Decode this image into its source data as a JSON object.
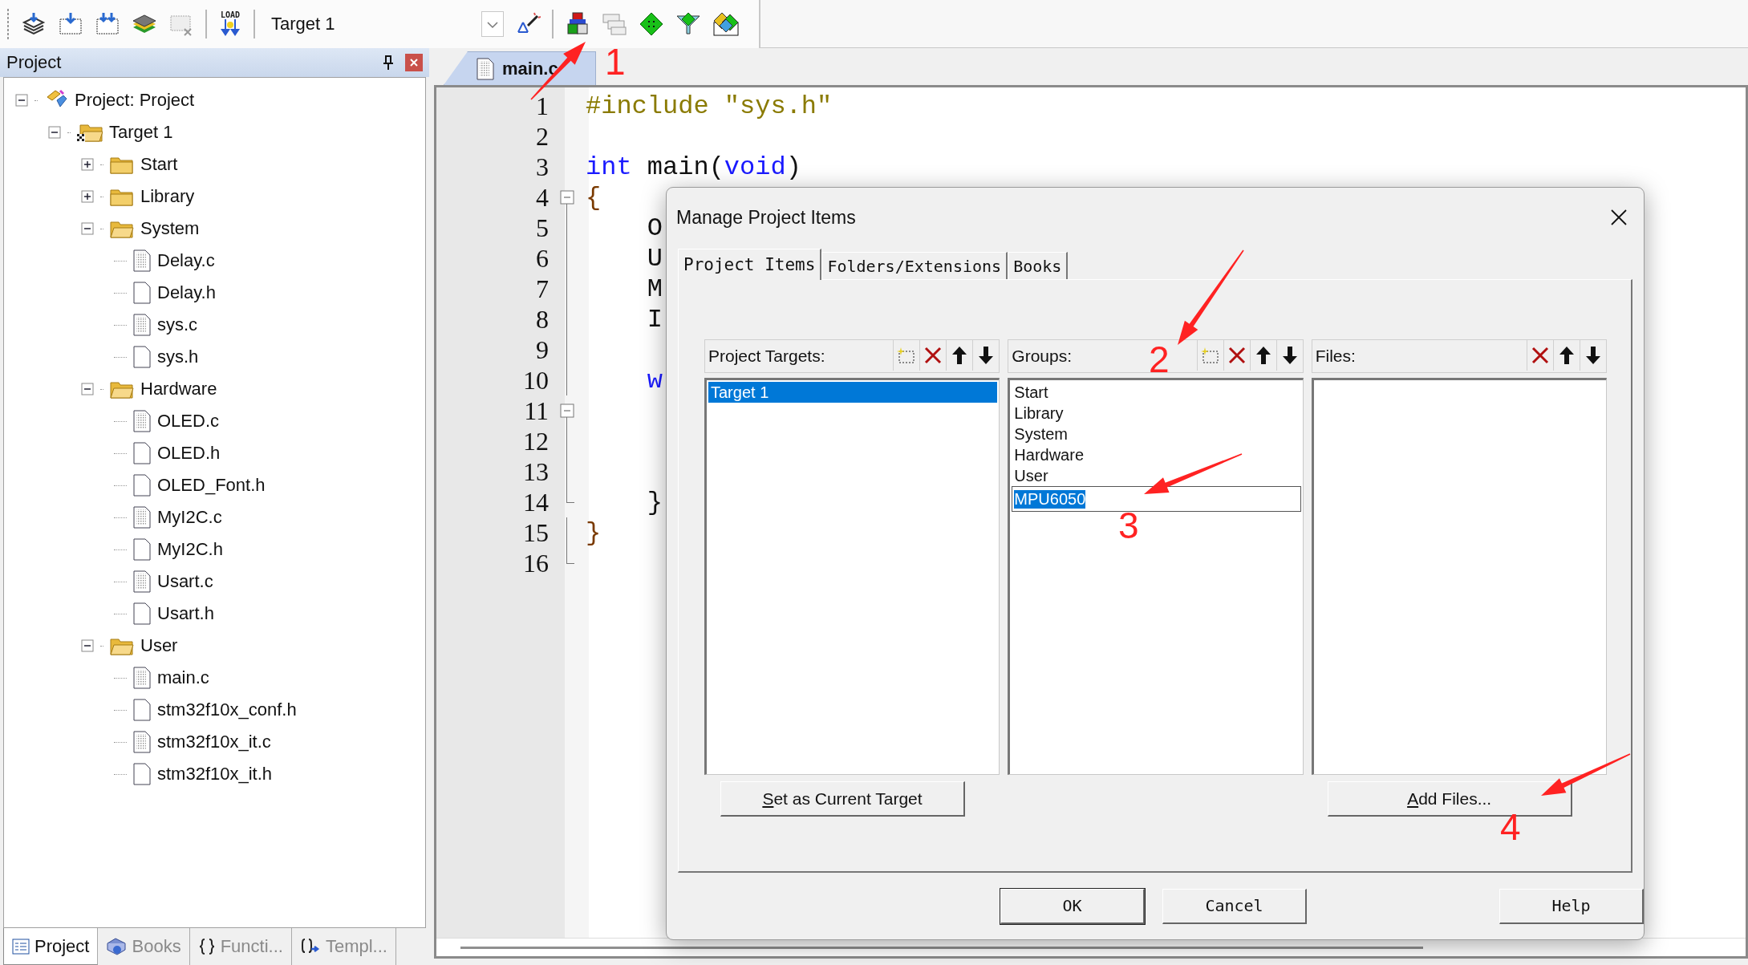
{
  "toolbar": {
    "load_label": "LOAD",
    "target_select": "Target 1"
  },
  "project_panel": {
    "title": "Project",
    "tree": [
      {
        "label": "Project: Project",
        "kind": "project",
        "expanded": true,
        "children": [
          {
            "label": "Target 1",
            "kind": "target",
            "expanded": true,
            "children": [
              {
                "label": "Start",
                "kind": "group",
                "expanded": false
              },
              {
                "label": "Library",
                "kind": "group",
                "expanded": false
              },
              {
                "label": "System",
                "kind": "group",
                "expanded": true,
                "children": [
                  {
                    "label": "Delay.c",
                    "kind": "source"
                  },
                  {
                    "label": "Delay.h",
                    "kind": "header"
                  },
                  {
                    "label": "sys.c",
                    "kind": "source"
                  },
                  {
                    "label": "sys.h",
                    "kind": "header"
                  }
                ]
              },
              {
                "label": "Hardware",
                "kind": "group",
                "expanded": true,
                "children": [
                  {
                    "label": "OLED.c",
                    "kind": "source"
                  },
                  {
                    "label": "OLED.h",
                    "kind": "header"
                  },
                  {
                    "label": "OLED_Font.h",
                    "kind": "header"
                  },
                  {
                    "label": "MyI2C.c",
                    "kind": "source"
                  },
                  {
                    "label": "MyI2C.h",
                    "kind": "header"
                  },
                  {
                    "label": "Usart.c",
                    "kind": "source"
                  },
                  {
                    "label": "Usart.h",
                    "kind": "header"
                  }
                ]
              },
              {
                "label": "User",
                "kind": "group",
                "expanded": true,
                "children": [
                  {
                    "label": "main.c",
                    "kind": "source"
                  },
                  {
                    "label": "stm32f10x_conf.h",
                    "kind": "header"
                  },
                  {
                    "label": "stm32f10x_it.c",
                    "kind": "source"
                  },
                  {
                    "label": "stm32f10x_it.h",
                    "kind": "header"
                  }
                ]
              }
            ]
          }
        ]
      }
    ],
    "bottom_tabs": [
      {
        "label": "Project",
        "kind": "project",
        "selected": true
      },
      {
        "label": "Books",
        "kind": "books",
        "selected": false
      },
      {
        "label": "Functi...",
        "kind": "functions",
        "selected": false
      },
      {
        "label": "Templ...",
        "kind": "templates",
        "selected": false
      }
    ]
  },
  "editor": {
    "tab": "main.c",
    "lines": [
      {
        "number": "1",
        "fold_box": false,
        "fold_end": false,
        "tokens": [
          {
            "text": "#include \"sys.h\"",
            "kind": "preprocessor"
          }
        ]
      },
      {
        "number": "2",
        "fold_box": false,
        "fold_end": false
      },
      {
        "number": "3",
        "fold_box": false,
        "fold_end": false,
        "tokens": [
          {
            "text": "int",
            "kind": "keyword"
          },
          {
            "text": " main(",
            "kind": "plain"
          },
          {
            "text": "void",
            "kind": "keyword"
          },
          {
            "text": ")",
            "kind": "plain"
          }
        ]
      },
      {
        "number": "4",
        "fold_box": true,
        "fold_end": false,
        "tokens": [
          {
            "text": "{",
            "kind": "brace"
          }
        ]
      },
      {
        "number": "5",
        "fold_box": false,
        "fold_end": false,
        "tokens": [
          {
            "text": "    O",
            "kind": "plain"
          }
        ]
      },
      {
        "number": "6",
        "fold_box": false,
        "fold_end": false,
        "tokens": [
          {
            "text": "    U",
            "kind": "plain"
          }
        ]
      },
      {
        "number": "7",
        "fold_box": false,
        "fold_end": false,
        "tokens": [
          {
            "text": "    M",
            "kind": "plain"
          }
        ]
      },
      {
        "number": "8",
        "fold_box": false,
        "fold_end": false,
        "tokens": [
          {
            "text": "    I",
            "kind": "plain"
          }
        ]
      },
      {
        "number": "9",
        "fold_box": false,
        "fold_end": false
      },
      {
        "number": "10",
        "fold_box": false,
        "fold_end": false,
        "tokens": [
          {
            "text": "    w",
            "kind": "keyword"
          }
        ]
      },
      {
        "number": "11",
        "fold_box": true,
        "fold_end": false
      },
      {
        "number": "12",
        "fold_box": false,
        "fold_end": false
      },
      {
        "number": "13",
        "fold_box": false,
        "fold_end": false
      },
      {
        "number": "14",
        "fold_box": false,
        "fold_end": true,
        "tokens": [
          {
            "text": "    }",
            "kind": "plain"
          }
        ]
      },
      {
        "number": "15",
        "fold_box": false,
        "fold_end": false,
        "tokens": [
          {
            "text": "}",
            "kind": "brace"
          }
        ]
      },
      {
        "number": "16",
        "fold_box": false,
        "fold_end": true
      }
    ]
  },
  "dialog": {
    "title": "Manage Project Items",
    "tabs": [
      {
        "label": "Project Items",
        "selected": true
      },
      {
        "label": "Folders/Extensions",
        "selected": false
      },
      {
        "label": "Books",
        "selected": false
      }
    ],
    "lists": [
      {
        "label": "Project Targets:",
        "tools": [
          {
            "kind": "new"
          },
          {
            "kind": "delete"
          },
          {
            "kind": "up"
          },
          {
            "kind": "down"
          }
        ],
        "items": [
          {
            "label": "Target 1",
            "selected": true
          }
        ],
        "button": {
          "label": "Set as Current Target",
          "mnemonic": true
        }
      },
      {
        "label": "Groups:",
        "tools": [
          {
            "kind": "new"
          },
          {
            "kind": "delete"
          },
          {
            "kind": "up"
          },
          {
            "kind": "down"
          }
        ],
        "items": [
          {
            "label": "Start",
            "selected": false
          },
          {
            "label": "Library",
            "selected": false
          },
          {
            "label": "System",
            "selected": false
          },
          {
            "label": "Hardware",
            "selected": false
          },
          {
            "label": "User",
            "selected": false
          }
        ],
        "new_item": {
          "value": "MPU6050",
          "selected": true
        }
      },
      {
        "label": "Files:",
        "tools": [
          {
            "kind": "delete"
          },
          {
            "kind": "up"
          },
          {
            "kind": "down"
          }
        ],
        "button": {
          "label": "Add Files...",
          "mnemonic": true
        }
      }
    ],
    "buttons": [
      {
        "label": "OK",
        "default": true
      },
      {
        "label": "Cancel",
        "default": false
      },
      {
        "label": "Help",
        "default": false
      }
    ]
  },
  "annotations": [
    {
      "label": "1"
    },
    {
      "label": "2"
    },
    {
      "label": "3"
    },
    {
      "label": "4"
    }
  ]
}
